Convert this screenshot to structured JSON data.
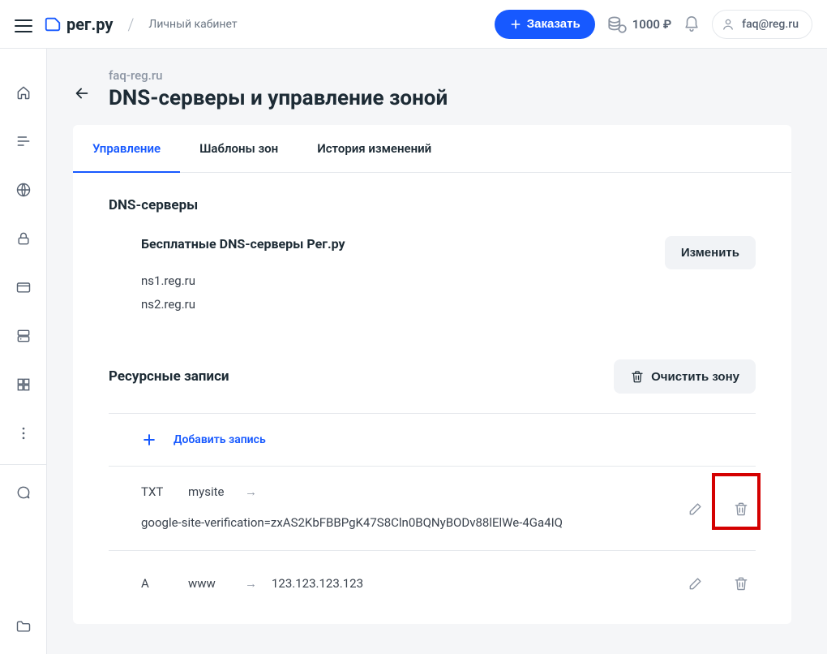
{
  "header": {
    "logo_text": "рег.ру",
    "breadcrumb": "Личный кабинет",
    "order_label": "Заказать",
    "balance": "1000 ₽",
    "user_email": "faq@reg.ru"
  },
  "page": {
    "domain": "faq-reg.ru",
    "title": "DNS-серверы и управление зоной"
  },
  "tabs": {
    "manage": "Управление",
    "templates": "Шаблоны зон",
    "history": "История изменений"
  },
  "dns_section": {
    "title": "DNS-серверы",
    "subtitle": "Бесплатные DNS-серверы Рег.ру",
    "servers": [
      "ns1.reg.ru",
      "ns2.reg.ru"
    ],
    "change_label": "Изменить"
  },
  "records_section": {
    "title": "Ресурсные записи",
    "clear_label": "Очистить зону",
    "add_label": "Добавить запись",
    "arrow": "→",
    "rows": [
      {
        "type": "TXT",
        "name": "mysite",
        "value": "google-site-verification=zxAS2KbFBBPgK47S8Cln0BQNyBODv88lElWe-4Ga4IQ"
      },
      {
        "type": "A",
        "name": "www",
        "value": "123.123.123.123"
      }
    ]
  }
}
